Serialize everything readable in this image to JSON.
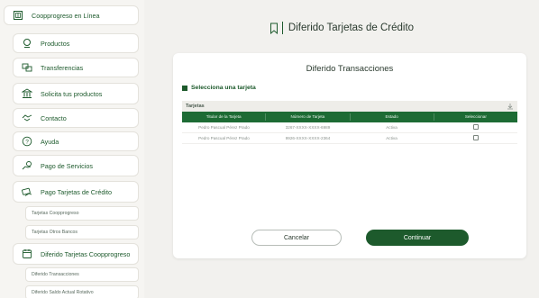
{
  "sidebar": {
    "top_item": {
      "label": "Coopprogreso en Línea",
      "icon": "bank-building-icon"
    },
    "items": [
      {
        "label": "Productos",
        "icon": "coin-icon"
      },
      {
        "label": "Transferencias",
        "icon": "transfer-icon"
      },
      {
        "label": "Solicita tus productos",
        "icon": "bank-icon"
      },
      {
        "label": "Contacto",
        "icon": "handshake-icon"
      },
      {
        "label": "Ayuda",
        "icon": "help-icon"
      },
      {
        "label": "Pago de Servicios",
        "icon": "service-payment-icon"
      },
      {
        "label": "Pago Tarjetas de Crédito",
        "icon": "card-payment-icon"
      }
    ],
    "card_payment_subitems": [
      {
        "label": "Tarjetas Coopprogreso"
      },
      {
        "label": "Tarjetas Otros Bancos"
      }
    ],
    "deferral_item": {
      "label": "Diferido Tarjetas Coopprogreso",
      "icon": "card-calendar-icon"
    },
    "deferral_subitems": [
      {
        "label": "Diferido Transacciones"
      },
      {
        "label": "Diferido Saldo Actual Rotativo"
      }
    ]
  },
  "page": {
    "title": "Diferido Tarjetas de Crédito",
    "title_icon": "bookmark-icon"
  },
  "card": {
    "title": "Diferido Transacciones",
    "section_label": "Selecciona una tarjeta",
    "table": {
      "caption": "Tarjetas",
      "download_icon": "download-icon",
      "columns": [
        "Titular de la Tarjeta",
        "Número de Tarjeta",
        "Estado",
        "Seleccionar"
      ],
      "rows": [
        {
          "holder": "Pedro Pascual Pérez Prado",
          "number": "3267-XXXX-XXXX-6989",
          "status": "Activa",
          "selected": false
        },
        {
          "holder": "Pedro Pascual Pérez Prado",
          "number": "9926-XXXX-XXXX-2364",
          "status": "Activa",
          "selected": false
        }
      ]
    },
    "cancel_label": "Cancelar",
    "continue_label": "Continuar"
  },
  "colors": {
    "brand_green": "#1d5a2c",
    "table_header_green": "#1d6b34",
    "background": "#f2f1ee"
  }
}
